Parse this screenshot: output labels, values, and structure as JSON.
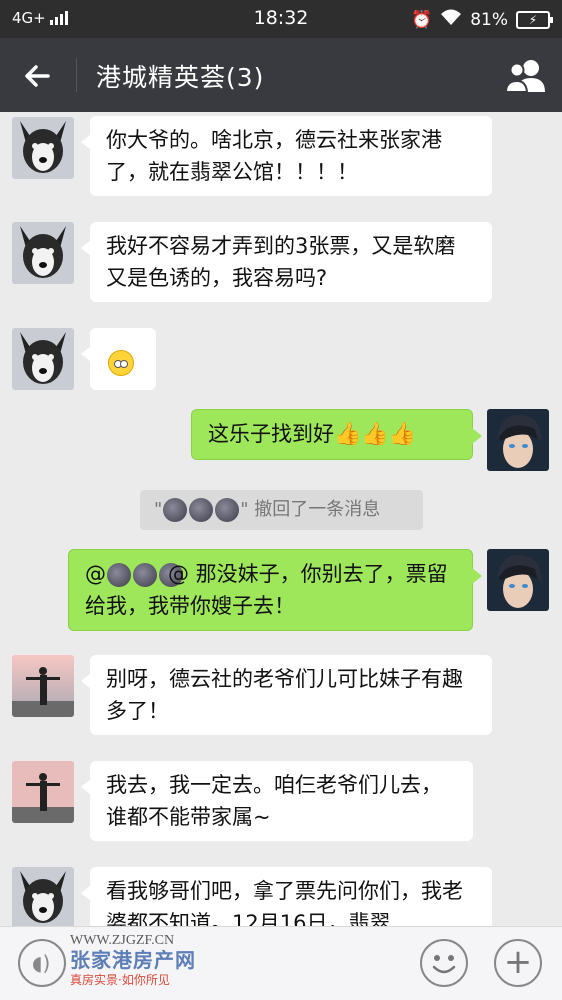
{
  "status_bar": {
    "network": "4G+",
    "time": "18:32",
    "battery": "81%"
  },
  "header": {
    "title": "港城精英荟(3)"
  },
  "messages": [
    {
      "text": "你大爷的。啥北京，德云社来张家港了，就在翡翠公馆！！！！"
    },
    {
      "text": "我好不容易才弄到的3张票，又是软磨又是色诱的，我容易吗?"
    },
    {
      "text": ""
    },
    {
      "text": "这乐子找到好"
    },
    {
      "text": "@ 那没妹子，你别去了，票留给我，我带你嫂子去！"
    },
    {
      "text": "别呀，德云社的老爷们儿可比妹子有趣多了！"
    },
    {
      "text": "我去，我一定去。咱仨老爷们儿去，谁都不能带家属~"
    },
    {
      "text": "看我够哥们吧，拿了票先问你们，我老婆都不知道。12月16日，翡翠"
    }
  ],
  "system": {
    "quote_open": "\"",
    "quote_close": "\"",
    "text": " 撤回了一条消息"
  },
  "watermark": {
    "url": "WWW.ZJGZF.CN",
    "name": "张家港房产网",
    "slogan": "真房实景·如你所见"
  },
  "icons": [
    "back-arrow-icon",
    "group-members-icon",
    "voice-icon",
    "emoji-icon",
    "plus-icon",
    "thumbs-up-icon",
    "moon-emoji-icon"
  ]
}
